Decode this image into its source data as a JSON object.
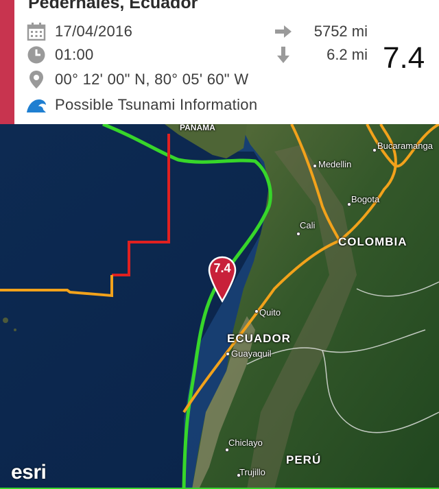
{
  "header": {
    "title": "Pedernales, Ecuador",
    "accent_color": "#c8344f"
  },
  "details": {
    "date": "17/04/2016",
    "time": "01:00",
    "coordinates": "00° 12' 00\" N, 80° 05' 60\" W",
    "tsunami": "Possible Tsunami Information",
    "distance": "5752 mi",
    "depth": "6.2 mi",
    "magnitude": "7.4",
    "icons": [
      "calendar-icon",
      "clock-icon",
      "location-pin-icon",
      "wave-icon",
      "arrow-right-icon",
      "arrow-down-icon"
    ]
  },
  "map": {
    "marker_label": "7.4",
    "marker_color": "#c8213a",
    "plate_boundary_colors": [
      "#37d62a",
      "#e02020",
      "#f2a21b"
    ],
    "countries": [
      "COLOMBIA",
      "ECUADOR",
      "PERÚ",
      "PANAMA"
    ],
    "cities": [
      "Bucaramanga",
      "Medellin",
      "Bogota",
      "Cali",
      "Quito",
      "Guayaquil",
      "Chiclayo",
      "Trujillo"
    ],
    "attribution": "esri"
  }
}
